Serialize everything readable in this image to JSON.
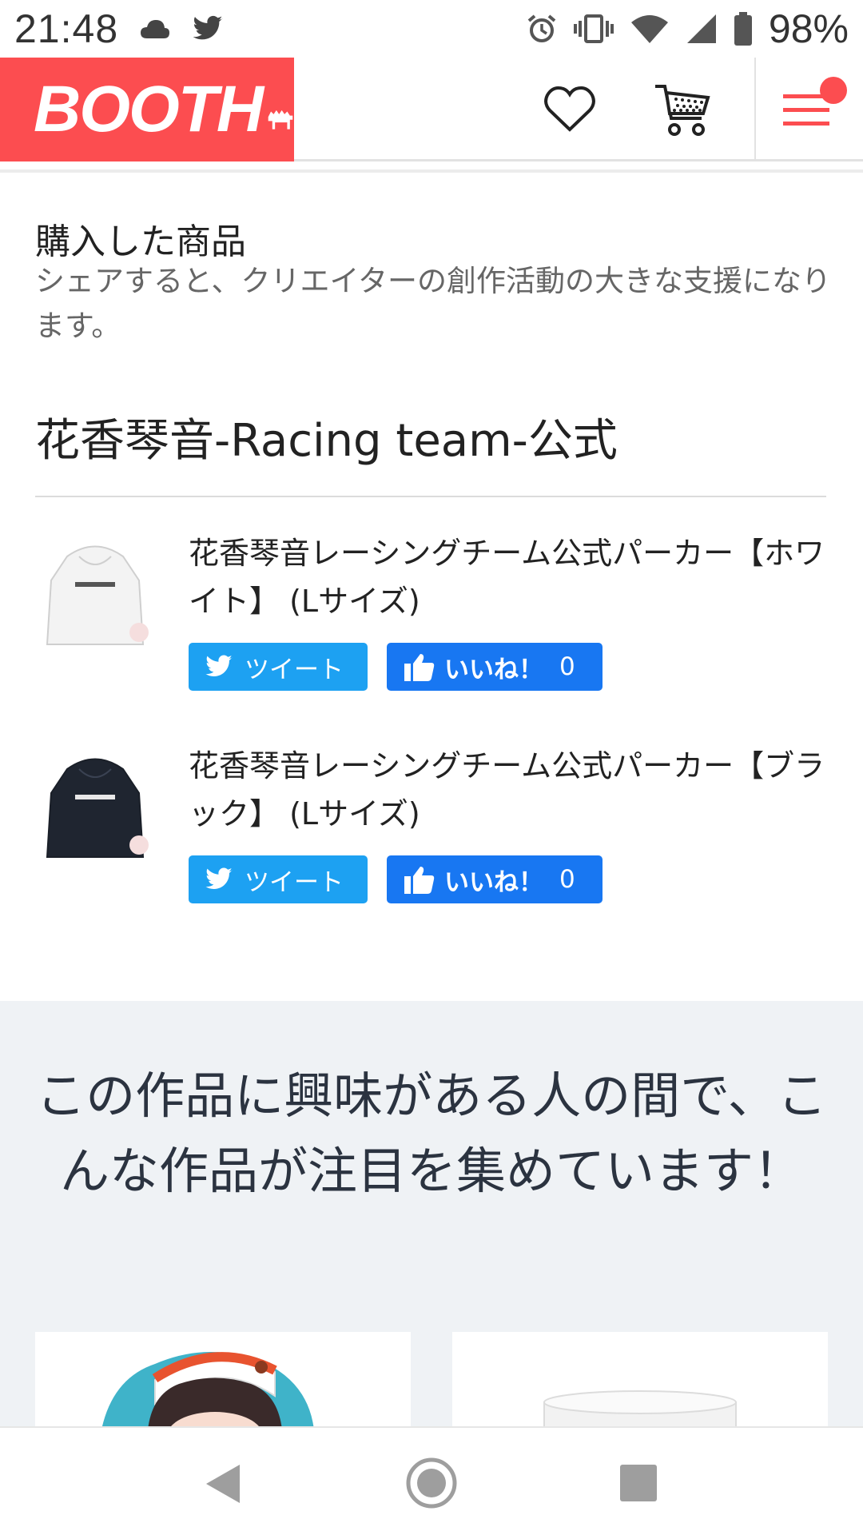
{
  "status_bar": {
    "time": "21:48",
    "icons_left": [
      "cloud-icon",
      "twitter-icon"
    ],
    "icons_right": [
      "alarm-icon",
      "vibrate-icon",
      "wifi-icon",
      "signal-icon",
      "battery-icon"
    ],
    "battery": "98%"
  },
  "header": {
    "logo": "BOOTH",
    "accent_color": "#fc4d50",
    "icons": [
      "heart-icon",
      "cart-icon",
      "menu-icon"
    ]
  },
  "purchased": {
    "title": "購入した商品",
    "subtitle": "シェアすると、クリエイターの創作活動の大きな支援になります。"
  },
  "shop": {
    "name": "花香琴音-Racing team-公式"
  },
  "items": [
    {
      "title": "花香琴音レーシングチーム公式パーカー【ホワイト】 (Lサイズ)",
      "tweet_label": "ツイート",
      "like_label": "いいね！",
      "like_count": "0"
    },
    {
      "title": "花香琴音レーシングチーム公式パーカー【ブラック】 (Lサイズ)",
      "tweet_label": "ツイート",
      "like_label": "いいね！",
      "like_count": "0"
    }
  ],
  "recommendation": {
    "title": "この作品に興味がある人の間で、こんな作品が注目を集めています！"
  },
  "colors": {
    "twitter": "#1da1f2",
    "facebook": "#1877f2",
    "rec_bg": "#eff2f5"
  },
  "nav": {
    "icons": [
      "back-icon",
      "home-icon",
      "recents-icon"
    ]
  }
}
